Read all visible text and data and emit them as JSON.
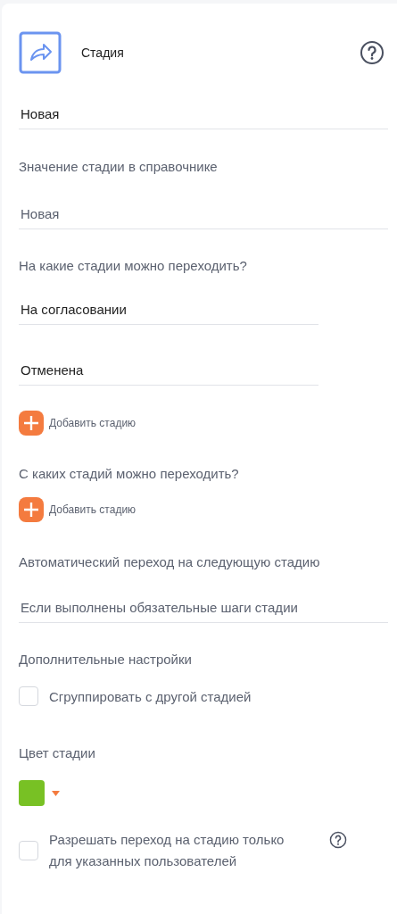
{
  "header": {
    "title": "Стадия"
  },
  "name_field": {
    "value": "Новая"
  },
  "directory": {
    "label": "Значение стадии в справочнике",
    "value": "Новая"
  },
  "to_stages": {
    "label": "На какие стадии можно переходить?",
    "items": [
      {
        "value": "На согласовании"
      },
      {
        "value": "Отменена"
      }
    ],
    "add_label": "Добавить стадию"
  },
  "from_stages": {
    "label": "С каких стадий можно переходить?",
    "add_label": "Добавить стадию"
  },
  "auto_transition": {
    "label": "Автоматический переход на следующую стадию",
    "value": "Если выполнены обязательные шаги стадии"
  },
  "extra": {
    "label": "Дополнительные настройки",
    "group": {
      "label": "Сгруппировать с другой стадией",
      "checked": false
    }
  },
  "stage_color": {
    "label": "Цвет стадии",
    "color": "#78c124"
  },
  "restrict": {
    "label": "Разрешать переход на стадию только для указанных пользователей",
    "checked": false
  }
}
